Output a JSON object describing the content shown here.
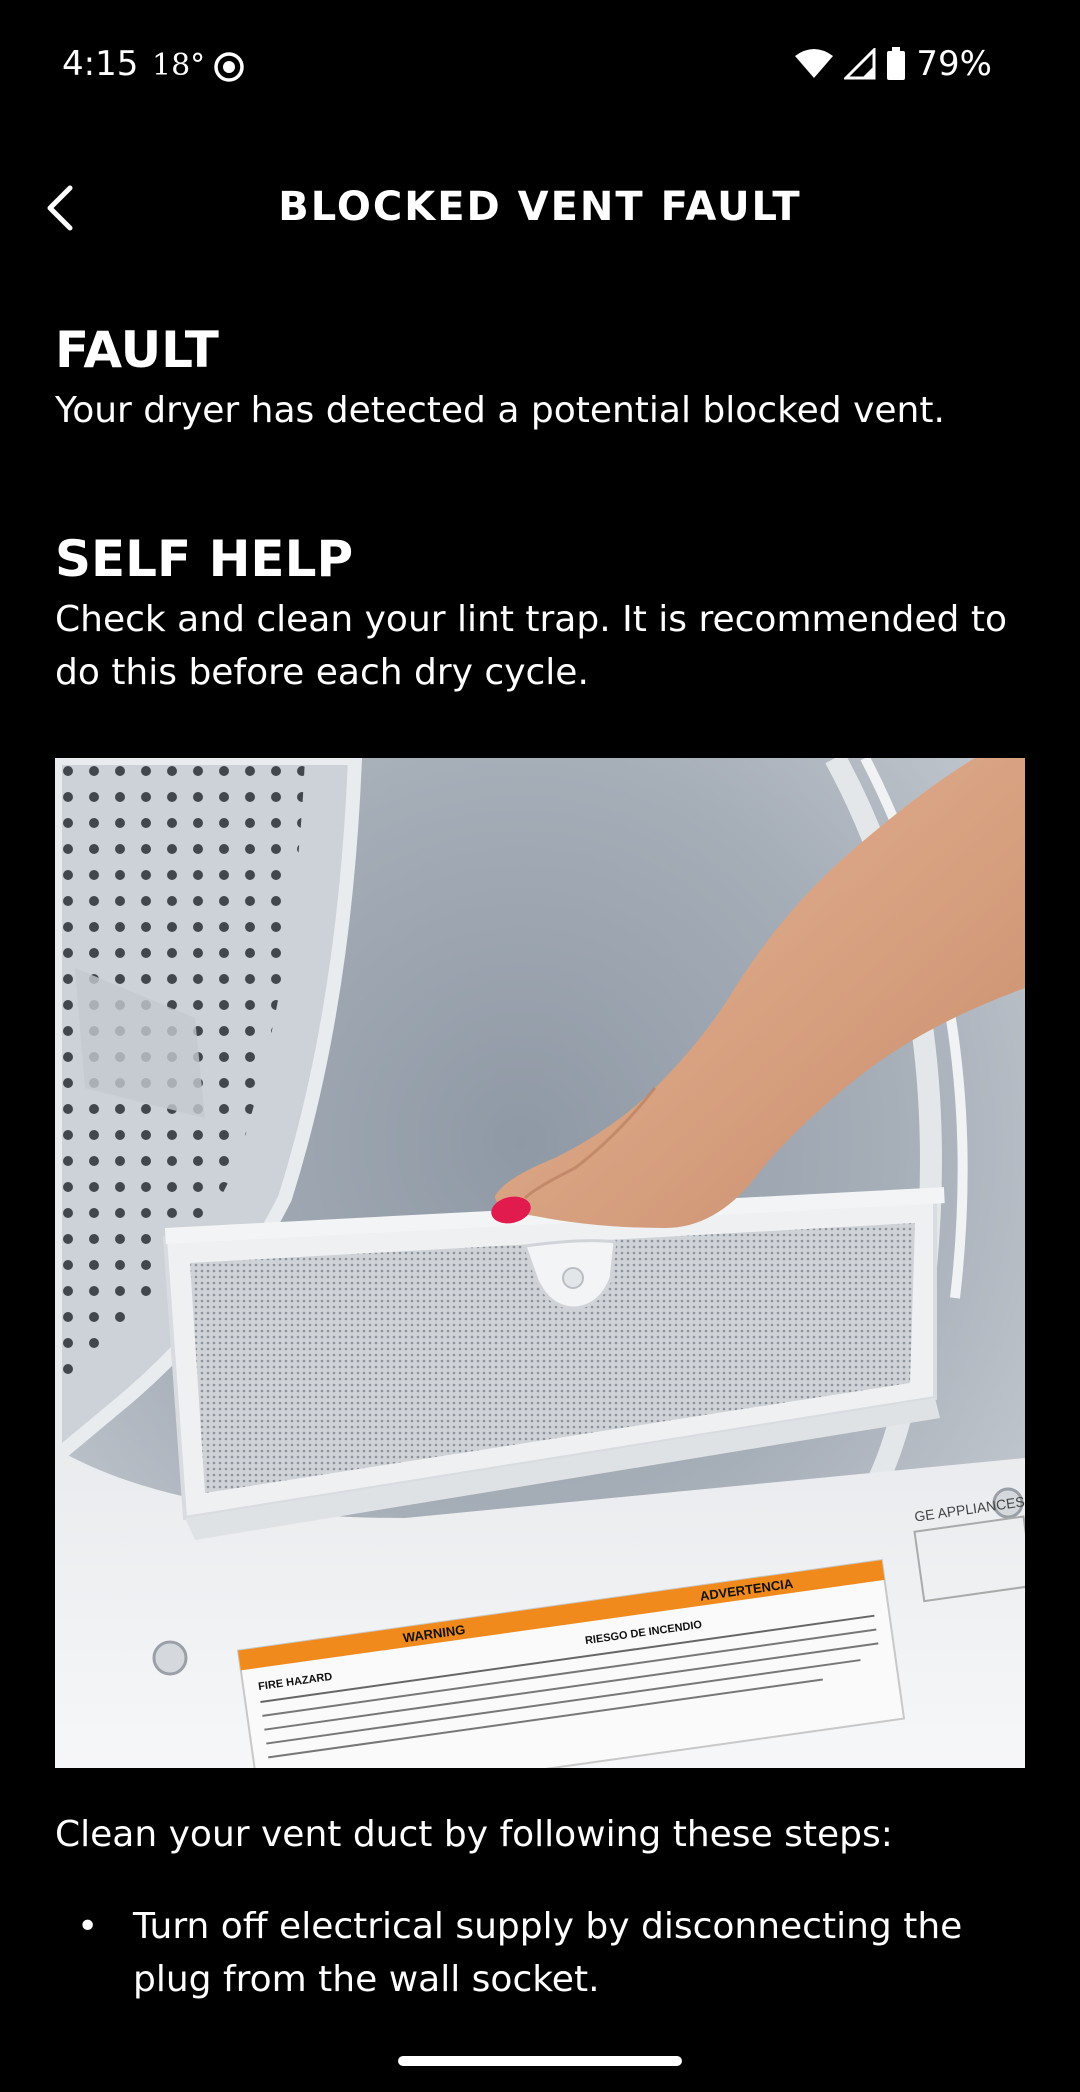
{
  "status_bar": {
    "time": "4:15",
    "temperature": "18°",
    "battery_percent": "79%"
  },
  "header": {
    "title": "BLOCKED VENT FAULT"
  },
  "fault": {
    "heading": "FAULT",
    "text": "Your dryer has detected a potential blocked vent."
  },
  "self_help": {
    "heading": "SELF HELP",
    "text": "Check and clean your lint trap. It is recommended to do this before each dry cycle."
  },
  "image": {
    "warning_title": "WARNING",
    "advertencia_title": "ADVERTENCIA",
    "fire_hazard_label": "FIRE HAZARD",
    "riesgo_label": "RIESGO DE INCENDIO",
    "brand": "GE APPLIANCES"
  },
  "steps": {
    "intro": "Clean your vent duct by following these steps:",
    "items": [
      {
        "bullet": "•",
        "text": "Turn off electrical supply by disconnecting the plug from the wall socket."
      }
    ]
  },
  "colors": {
    "background": "#000000",
    "text": "#ffffff",
    "warning_orange": "#f08a1c"
  },
  "icons": {
    "back": "chevron-left-icon",
    "wifi": "wifi-icon",
    "signal": "signal-icon",
    "battery": "battery-icon",
    "record": "screen-record-icon"
  }
}
